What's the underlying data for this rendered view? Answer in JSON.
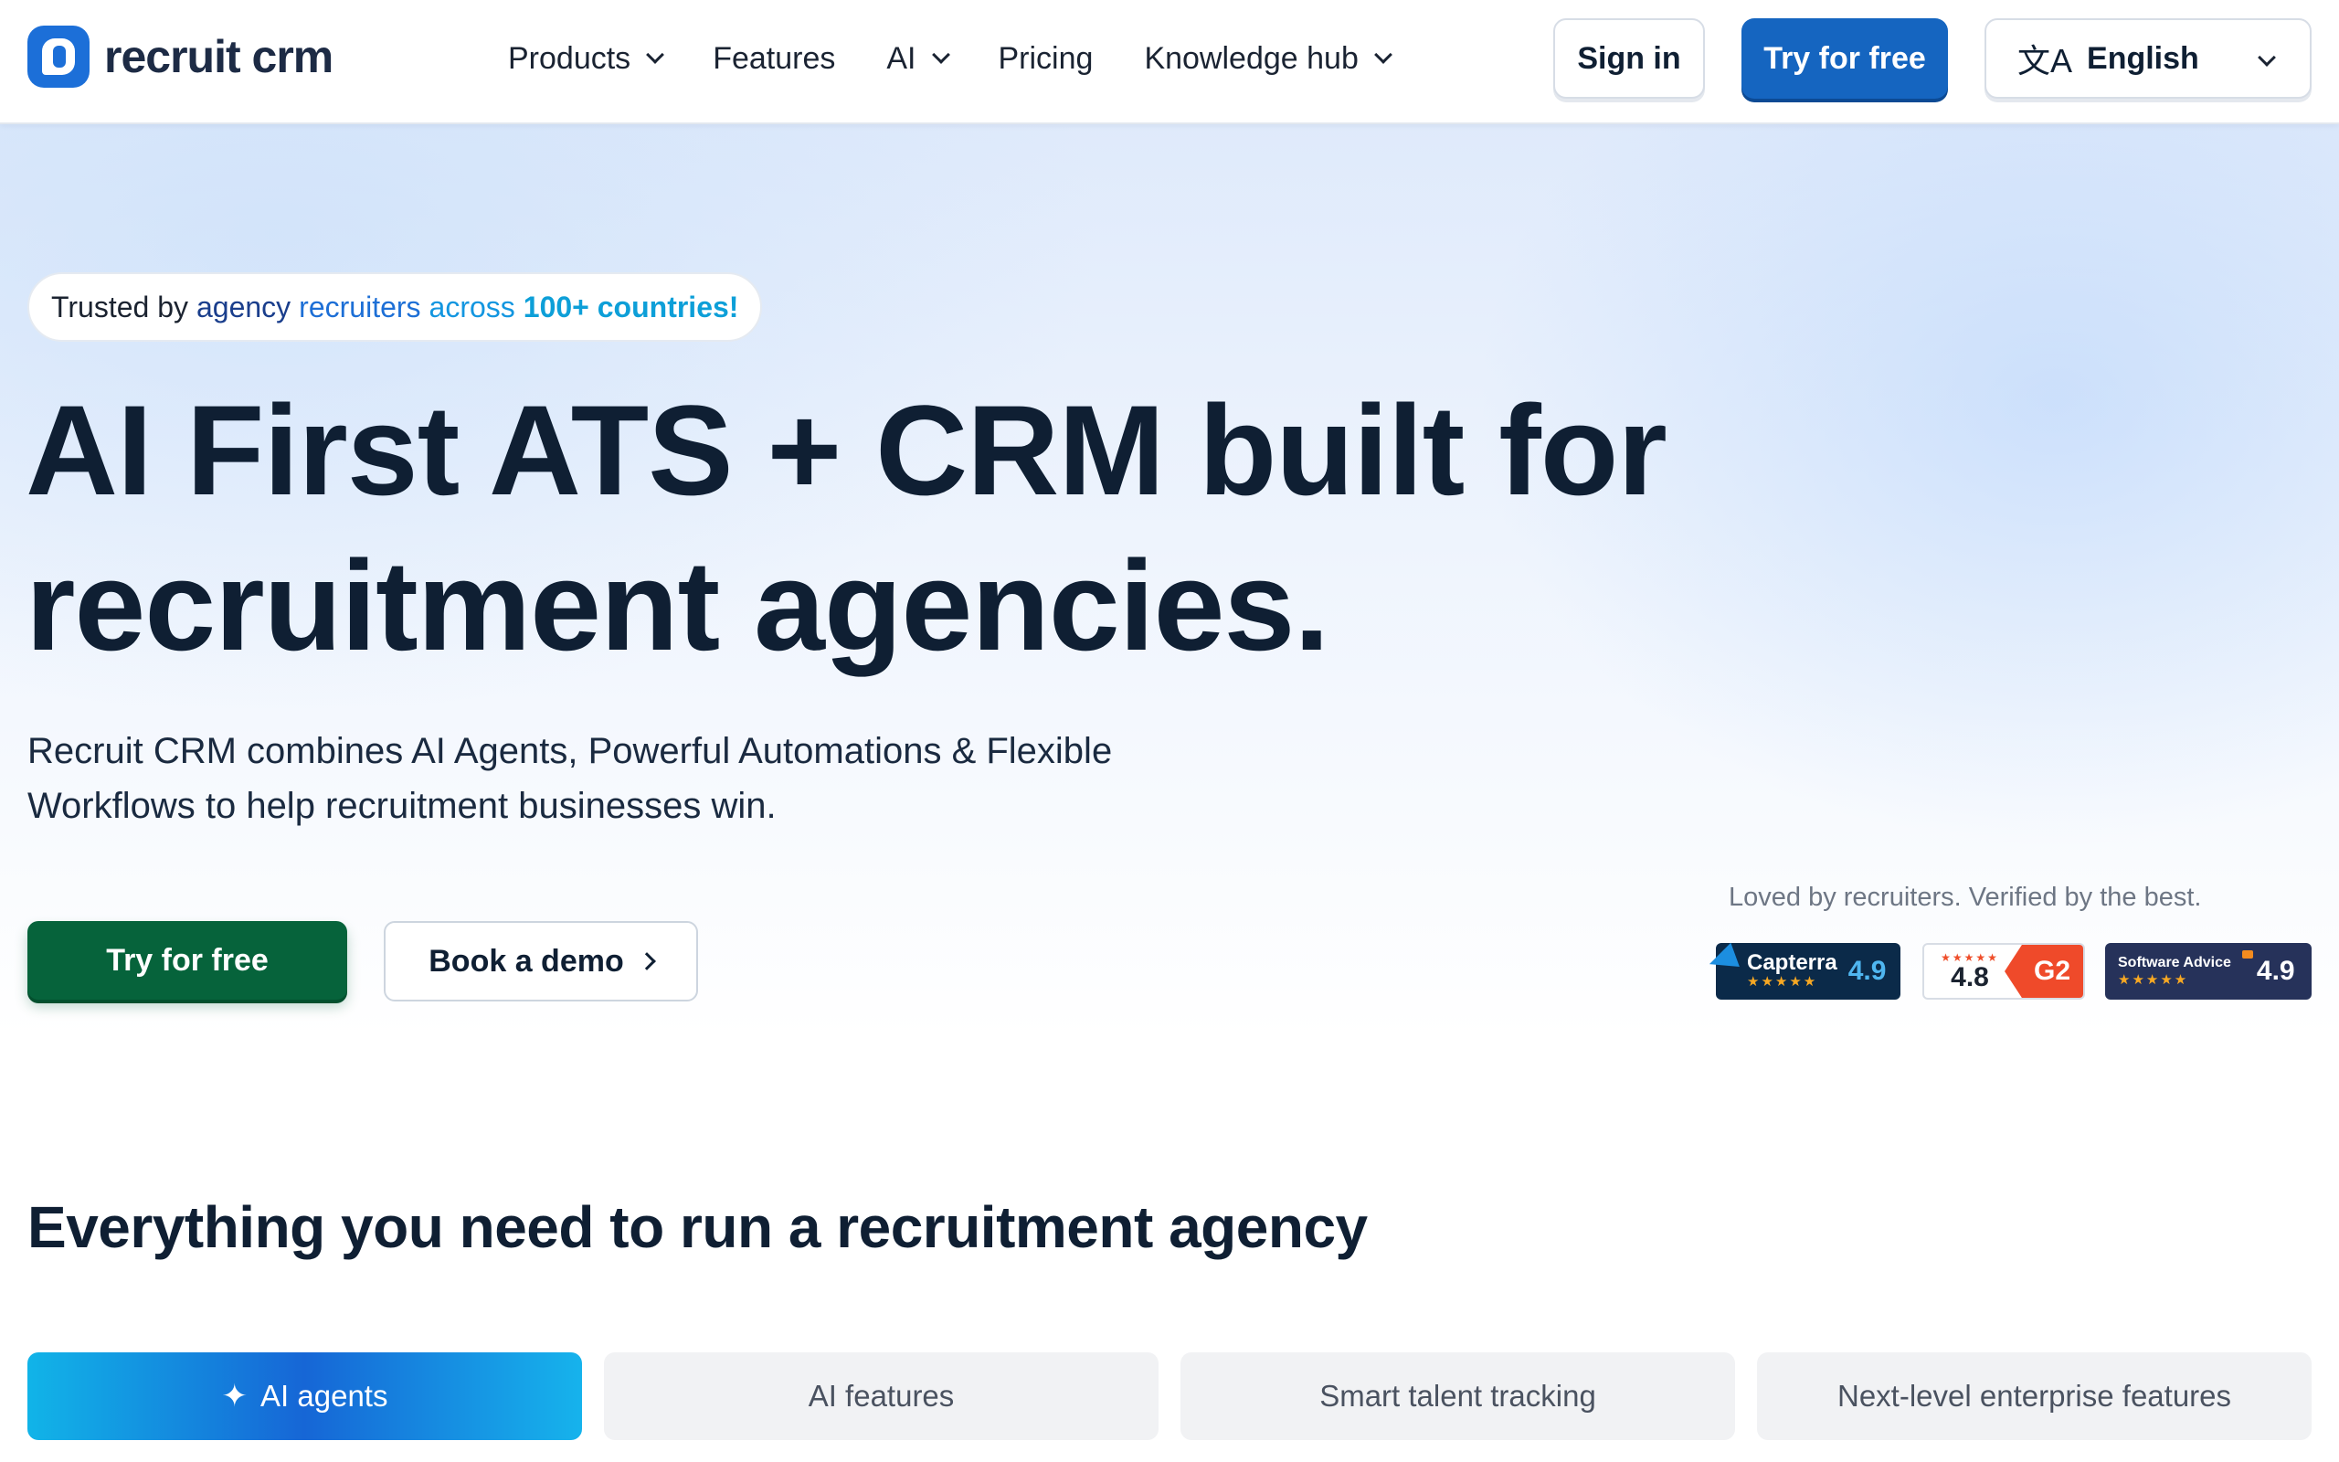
{
  "brand": {
    "name": "recruit crm",
    "color": "#1c6fd8"
  },
  "nav": {
    "links": [
      {
        "label": "Products",
        "has_dropdown": true
      },
      {
        "label": "Features",
        "has_dropdown": false
      },
      {
        "label": "AI",
        "has_dropdown": true
      },
      {
        "label": "Pricing",
        "has_dropdown": false
      },
      {
        "label": "Knowledge hub",
        "has_dropdown": true
      }
    ],
    "sign_in": "Sign in",
    "try_free": "Try for free",
    "language": {
      "icon": "translate-icon",
      "glyph": "文A",
      "selected": "English"
    }
  },
  "hero": {
    "trust_pill": {
      "part1": "Trusted by",
      "part2": "agency",
      "part3": "recruiters",
      "part4": "across",
      "part5": "100+ countries!"
    },
    "headline_line1": "AI First ATS + CRM built for",
    "headline_line2": "recruitment agencies.",
    "subtext_line1": "Recruit CRM combines AI Agents, Powerful Automations & Flexible",
    "subtext_line2": "Workflows to help recruitment businesses win.",
    "cta_primary": "Try for free",
    "cta_secondary": "Book a demo",
    "cta_primary_color": "#06633b"
  },
  "ratings": {
    "tagline": "Loved by recruiters. Verified by the best.",
    "capterra": {
      "name": "Capterra",
      "score": "4.9",
      "stars": "★★★★★"
    },
    "g2": {
      "name": "G2",
      "score": "4.8",
      "stars": "★★★★★"
    },
    "software_advice": {
      "name": "Software Advice",
      "score": "4.9",
      "stars": "★★★★★"
    }
  },
  "section": {
    "title": "Everything you need to run a recruitment agency",
    "tabs": [
      {
        "label": "AI agents",
        "active": true,
        "icon": "sparkle-icon"
      },
      {
        "label": "AI features",
        "active": false
      },
      {
        "label": "Smart talent tracking",
        "active": false
      },
      {
        "label": "Next-level enterprise features",
        "active": false
      }
    ]
  }
}
